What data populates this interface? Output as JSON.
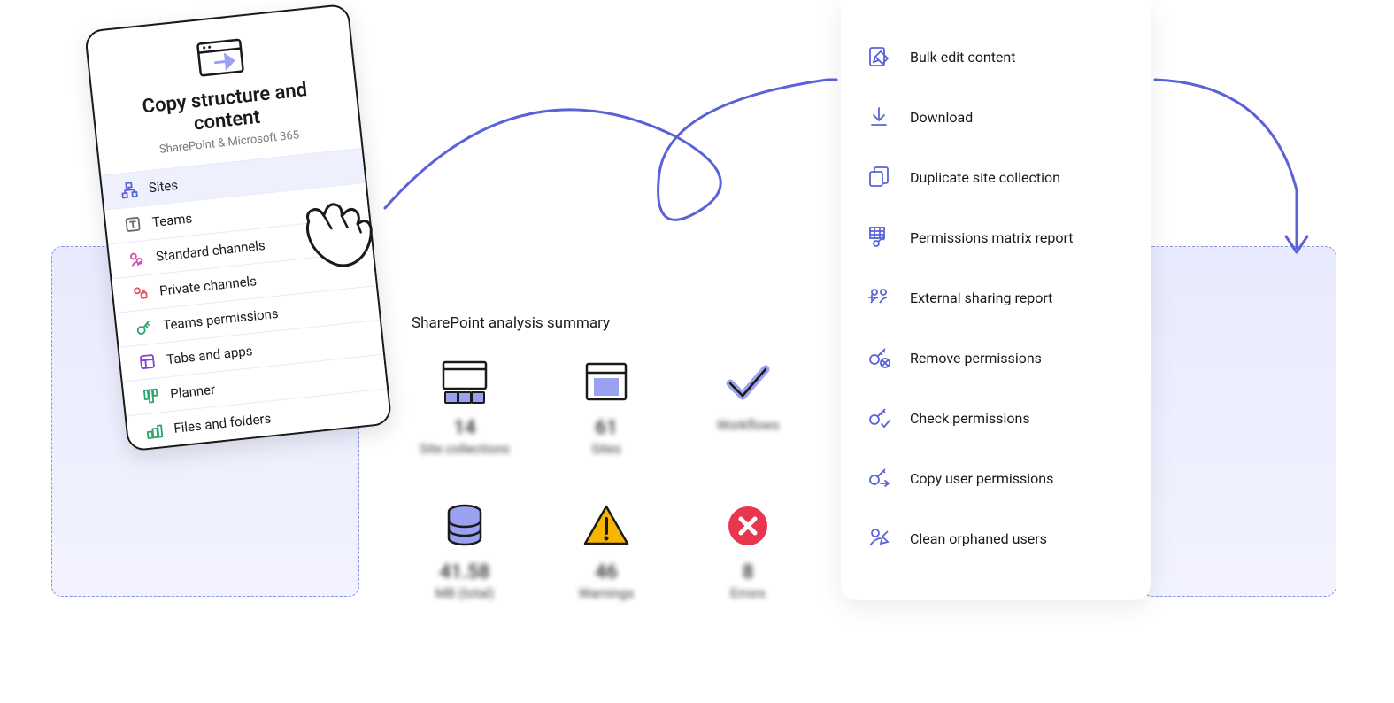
{
  "copy_card": {
    "title": "Copy structure and content",
    "subtitle": "SharePoint & Microsoft 365",
    "items": [
      {
        "icon": "sites-icon",
        "label": "Sites",
        "color": "#5a62d8",
        "selected": true
      },
      {
        "icon": "teams-icon",
        "label": "Teams",
        "color": "#6b6b6b",
        "selected": false
      },
      {
        "icon": "channels-icon",
        "label": "Standard channels",
        "color": "#d14cb0",
        "selected": false
      },
      {
        "icon": "private-channels-icon",
        "label": "Private channels",
        "color": "#e0555f",
        "selected": false
      },
      {
        "icon": "key-icon",
        "label": "Teams permissions",
        "color": "#2ea56e",
        "selected": false
      },
      {
        "icon": "tabs-icon",
        "label": "Tabs and apps",
        "color": "#8a3ed8",
        "selected": false
      },
      {
        "icon": "planner-icon",
        "label": "Planner",
        "color": "#2ea56e",
        "selected": false
      },
      {
        "icon": "files-icon",
        "label": "Files and folders",
        "color": "#2ea56e",
        "selected": false
      }
    ]
  },
  "analysis": {
    "title": "SharePoint analysis summary",
    "stats": [
      {
        "icon": "site-collections-icon",
        "value": "14",
        "label": "Site collections"
      },
      {
        "icon": "site-icon",
        "value": "61",
        "label": "Sites"
      },
      {
        "icon": "check-icon",
        "value": "",
        "label": "Workflows"
      },
      {
        "icon": "storage-icon",
        "value": "41.58",
        "label": "MB (total)"
      },
      {
        "icon": "warning-icon",
        "value": "46",
        "label": "Warnings"
      },
      {
        "icon": "error-icon",
        "value": "8",
        "label": "Errors"
      }
    ]
  },
  "actions": {
    "items": [
      {
        "icon": "edit-icon",
        "label": "Bulk edit content"
      },
      {
        "icon": "download-icon",
        "label": "Download"
      },
      {
        "icon": "duplicate-icon",
        "label": "Duplicate site collection"
      },
      {
        "icon": "matrix-icon",
        "label": "Permissions matrix report"
      },
      {
        "icon": "share-icon",
        "label": "External sharing report"
      },
      {
        "icon": "remove-perm-icon",
        "label": "Remove permissions"
      },
      {
        "icon": "check-perm-icon",
        "label": "Check permissions"
      },
      {
        "icon": "copy-perm-icon",
        "label": "Copy user permissions"
      },
      {
        "icon": "clean-icon",
        "label": "Clean orphaned users"
      }
    ]
  },
  "colors": {
    "accent": "#5a62d8",
    "ink": "#1a1a1a",
    "warn": "#f7b500",
    "error": "#e8364e"
  }
}
